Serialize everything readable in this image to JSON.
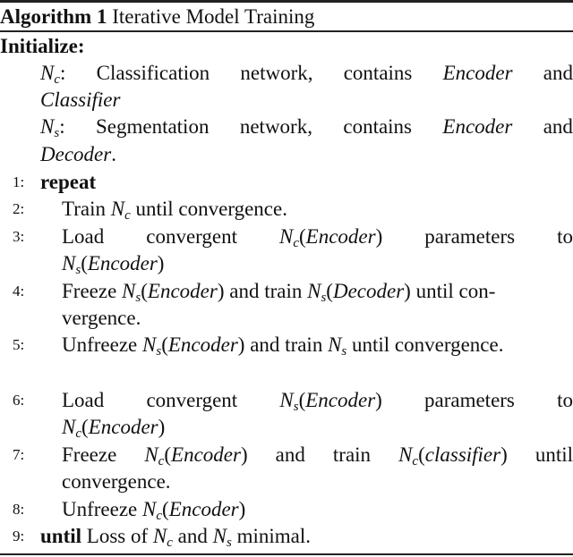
{
  "algorithm": {
    "label": "Algorithm 1",
    "title": "Iterative Model Training",
    "initialize_label": "Initialize:",
    "init": [
      {
        "var": "N",
        "sub": "c",
        "text": ": Classification network, contains",
        "term1": "Encoder",
        "and": "and",
        "term2": "Classifier"
      },
      {
        "var": "N",
        "sub": "s",
        "text": ": Segmentation network, contains",
        "term1": "Encoder",
        "and": "and",
        "term2": "Decoder",
        "end": "."
      }
    ],
    "steps": [
      {
        "num": "1:",
        "keyword": "repeat"
      },
      {
        "num": "2:",
        "pre": "Train",
        "var": "N",
        "sub": "c",
        "post": "until convergence."
      },
      {
        "num": "3:",
        "w1": "Load",
        "w2": "convergent",
        "arg": "Encoder",
        "w3": "parameters",
        "w4": "to",
        "cont_arg": "Encoder"
      },
      {
        "num": "4:",
        "a": "Freeze",
        "arg1": "Encoder",
        "b": "and train",
        "arg2": "Decoder",
        "c": "until con-",
        "cont": "vergence."
      },
      {
        "num": "5:",
        "a": "Unfreeze",
        "arg1": "Encoder",
        "b": "and train",
        "c": "until convergence."
      },
      {
        "num": "6:",
        "w1": "Load",
        "w2": "convergent",
        "arg": "Encoder",
        "w3": "parameters",
        "w4": "to",
        "cont_arg": "Encoder"
      },
      {
        "num": "7:",
        "a": "Freeze",
        "arg1": "Encoder",
        "b": "and",
        "b2": "train",
        "arg2": "classifier",
        "c": "until",
        "cont": "convergence."
      },
      {
        "num": "8:",
        "a": "Unfreeze",
        "arg1": "Encoder"
      },
      {
        "num": "9:",
        "keyword": "until",
        "a": "Loss of",
        "b": "and",
        "c": "minimal."
      }
    ],
    "symbols": {
      "N": "N",
      "c": "c",
      "s": "s",
      "lp": "(",
      "rp": ")"
    }
  }
}
